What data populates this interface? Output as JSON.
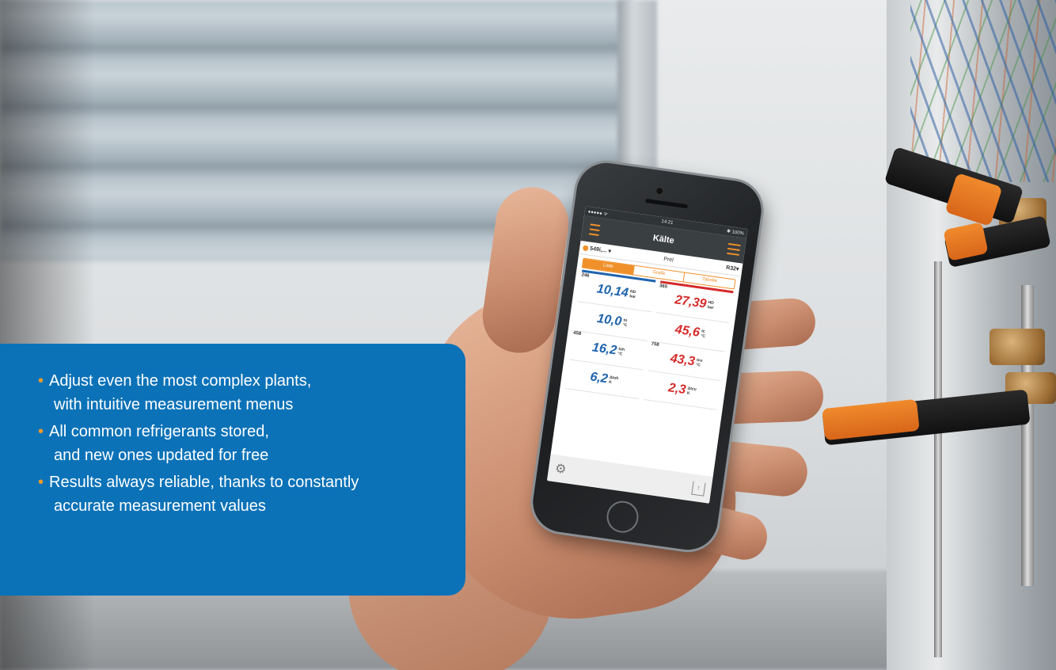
{
  "phone": {
    "status": {
      "carrier": "●●●●● ᯤ",
      "time": "14:21",
      "battery": "✱ 100%"
    },
    "app_title": "Kälte",
    "probe_label": "549i,...",
    "pressure_mode": "Prel",
    "refrigerant": "R32",
    "tabs": [
      {
        "label": "Liste",
        "active": true
      },
      {
        "label": "Grafik",
        "active": false
      },
      {
        "label": "Tabelle",
        "active": false
      }
    ],
    "left_column": {
      "bar_color": "#1f63ad",
      "rows": [
        {
          "tag": "246",
          "value": "10,14",
          "symbol": "ND",
          "unit": "bar"
        },
        {
          "tag": "",
          "value": "10,0",
          "symbol": "to",
          "unit": "°C"
        },
        {
          "tag": "458",
          "value": "16,2",
          "symbol": "toh",
          "unit": "°C"
        },
        {
          "tag": "",
          "value": "6,2",
          "symbol": "Δtoh",
          "unit": "K"
        }
      ]
    },
    "right_column": {
      "bar_color": "#d42a2a",
      "rows": [
        {
          "tag": "365",
          "value": "27,39",
          "symbol": "HD",
          "unit": "bar"
        },
        {
          "tag": "",
          "value": "45,6",
          "symbol": "tc",
          "unit": "°C"
        },
        {
          "tag": "758",
          "value": "43,3",
          "symbol": "tcu",
          "unit": "°C"
        },
        {
          "tag": "",
          "value": "2,3",
          "symbol": "Δtcu",
          "unit": "K"
        }
      ]
    },
    "footer": {
      "settings_icon": "gear-icon",
      "share_icon": "share-icon"
    }
  },
  "info_box": {
    "background": "#0b72b8",
    "bullet_color": "#f39a2b",
    "bullets": [
      {
        "line1": "Adjust even the most complex plants,",
        "line2": "with intuitive measurement menus"
      },
      {
        "line1": "All common refrigerants stored,",
        "line2": "and new ones updated for free"
      },
      {
        "line1": "Results always reliable, thanks to constantly",
        "line2": "accurate measurement values"
      }
    ]
  }
}
